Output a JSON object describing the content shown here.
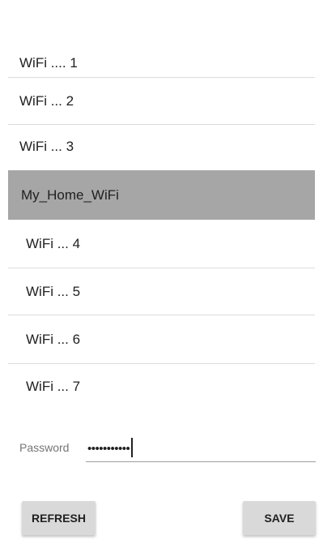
{
  "wifi_list": {
    "items": [
      {
        "label": "WiFi .... 1"
      },
      {
        "label": "WiFi ... 2"
      },
      {
        "label": "WiFi ... 3"
      },
      {
        "label": "My_Home_WiFi",
        "selected": true
      },
      {
        "label": "WiFi ... 4"
      },
      {
        "label": "WiFi ... 5"
      },
      {
        "label": "WiFi ... 6"
      },
      {
        "label": "WiFi ... 7"
      }
    ],
    "selected_color": "#a6a6a6"
  },
  "password": {
    "label": "Password",
    "value": "•••••••••••"
  },
  "actions": {
    "refresh_label": "REFRESH",
    "save_label": "SAVE"
  }
}
